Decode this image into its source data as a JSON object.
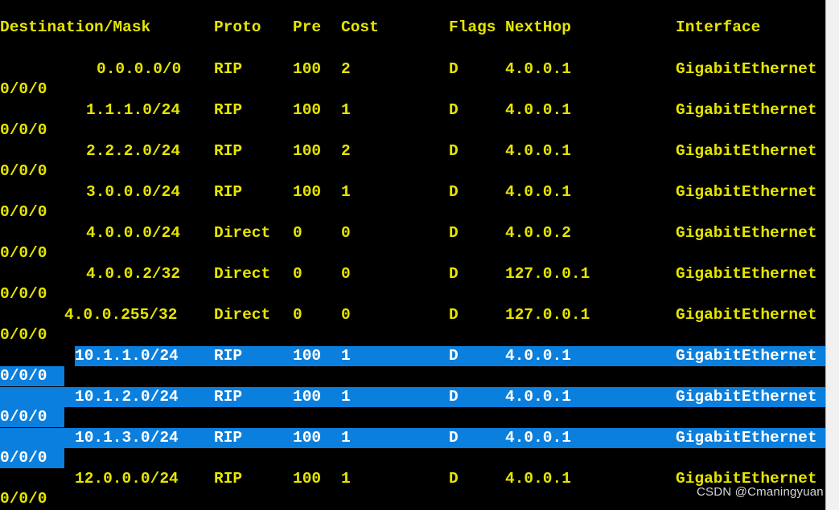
{
  "terminal": {
    "background_color": "#000000",
    "text_color": "#e5e500",
    "selection_background_color": "#0b7fdd",
    "selection_text_color": "#ffffff",
    "watermark": "CSDN @Cmaningyuan"
  },
  "header": {
    "destination_mask": "Destination/Mask",
    "proto": "Proto",
    "pre": "Pre",
    "cost": "Cost",
    "flags": "Flags",
    "nexthop": "NextHop",
    "interface": "Interface"
  },
  "routes": [
    {
      "destination": "0.0.0.0/0",
      "proto": "RIP",
      "pre": "100",
      "cost": "2",
      "flags": "D",
      "nexthop": "4.0.0.1",
      "interface": "GigabitEthernet",
      "interface_wrap": "0/0/0",
      "selected": false
    },
    {
      "destination": "1.1.1.0/24",
      "proto": "RIP",
      "pre": "100",
      "cost": "1",
      "flags": "D",
      "nexthop": "4.0.0.1",
      "interface": "GigabitEthernet",
      "interface_wrap": "0/0/0",
      "selected": false
    },
    {
      "destination": "2.2.2.0/24",
      "proto": "RIP",
      "pre": "100",
      "cost": "2",
      "flags": "D",
      "nexthop": "4.0.0.1",
      "interface": "GigabitEthernet",
      "interface_wrap": "0/0/0",
      "selected": false
    },
    {
      "destination": "3.0.0.0/24",
      "proto": "RIP",
      "pre": "100",
      "cost": "1",
      "flags": "D",
      "nexthop": "4.0.0.1",
      "interface": "GigabitEthernet",
      "interface_wrap": "0/0/0",
      "selected": false
    },
    {
      "destination": "4.0.0.0/24",
      "proto": "Direct",
      "pre": "0",
      "cost": "0",
      "flags": "D",
      "nexthop": "4.0.0.2",
      "interface": "GigabitEthernet",
      "interface_wrap": "0/0/0",
      "selected": false
    },
    {
      "destination": "4.0.0.2/32",
      "proto": "Direct",
      "pre": "0",
      "cost": "0",
      "flags": "D",
      "nexthop": "127.0.0.1",
      "interface": "GigabitEthernet",
      "interface_wrap": "0/0/0",
      "selected": false
    },
    {
      "destination": "4.0.0.255/32",
      "proto": "Direct",
      "pre": "0",
      "cost": "0",
      "flags": "D",
      "nexthop": "127.0.0.1",
      "interface": "GigabitEthernet",
      "interface_wrap": "0/0/0",
      "selected": false
    },
    {
      "destination": "10.1.1.0/24",
      "proto": "RIP",
      "pre": "100",
      "cost": "1",
      "flags": "D",
      "nexthop": "4.0.0.1",
      "interface": "GigabitEthernet",
      "interface_wrap": "0/0/0",
      "selected": true
    },
    {
      "destination": "10.1.2.0/24",
      "proto": "RIP",
      "pre": "100",
      "cost": "1",
      "flags": "D",
      "nexthop": "4.0.0.1",
      "interface": "GigabitEthernet",
      "interface_wrap": "0/0/0",
      "selected": true
    },
    {
      "destination": "10.1.3.0/24",
      "proto": "RIP",
      "pre": "100",
      "cost": "1",
      "flags": "D",
      "nexthop": "4.0.0.1",
      "interface": "GigabitEthernet",
      "interface_wrap": "0/0/0",
      "selected": true
    },
    {
      "destination": "12.0.0.0/24",
      "proto": "RIP",
      "pre": "100",
      "cost": "1",
      "flags": "D",
      "nexthop": "4.0.0.1",
      "interface": "GigabitEthernet",
      "interface_wrap": "0/0/0",
      "selected": false
    }
  ]
}
